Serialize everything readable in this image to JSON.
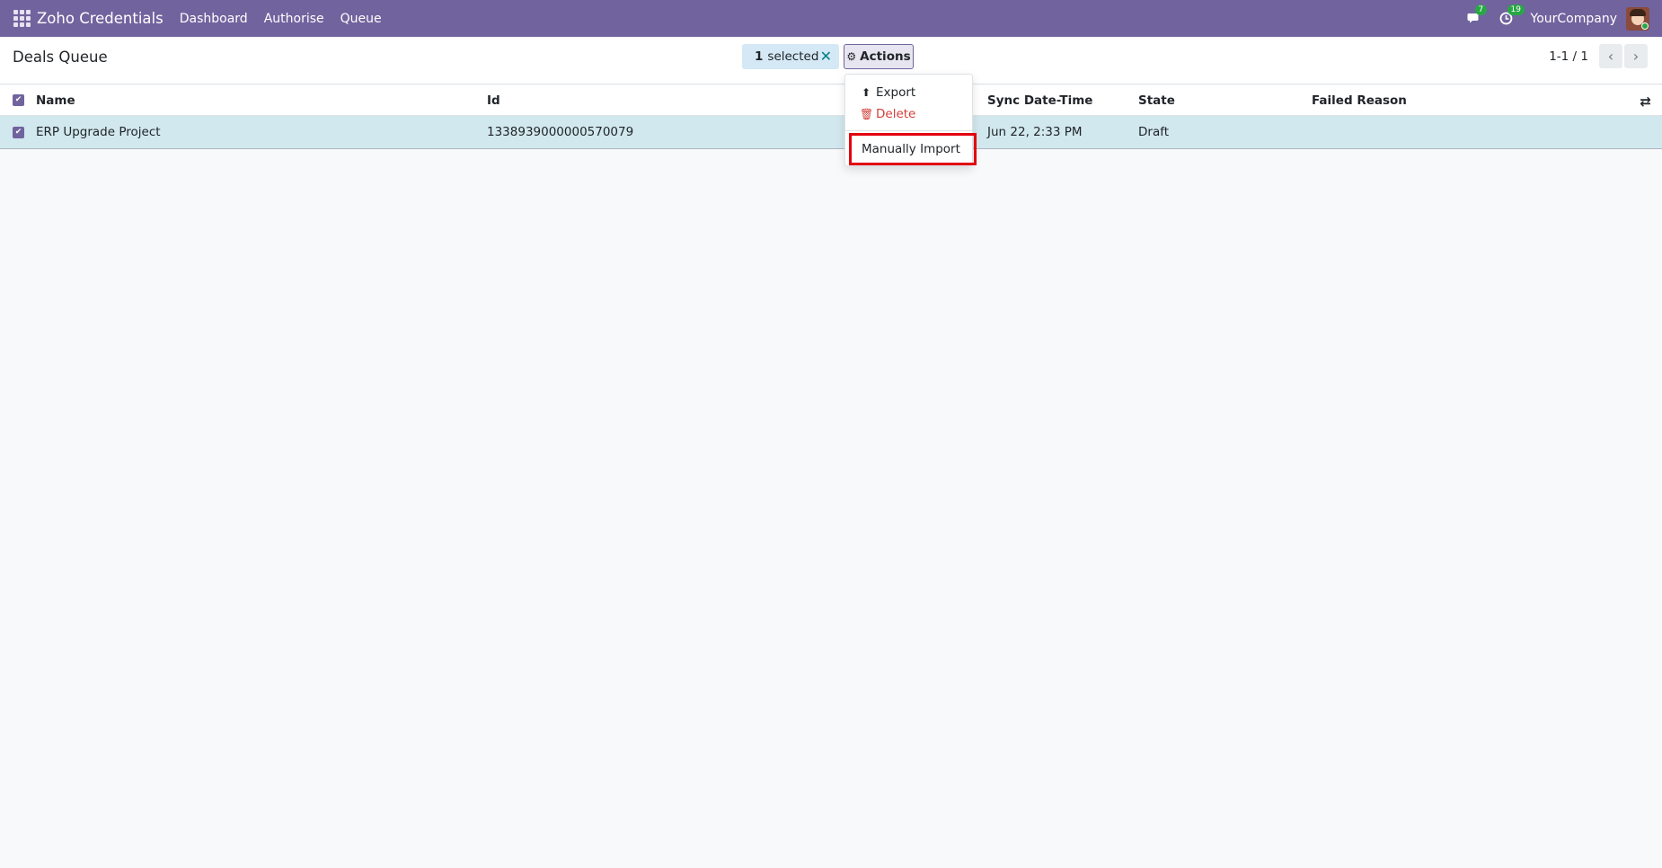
{
  "navbar": {
    "app_title": "Zoho Credentials",
    "menu": [
      "Dashboard",
      "Authorise",
      "Queue"
    ],
    "messages_badge": "7",
    "activities_badge": "19",
    "company": "YourCompany",
    "icons": [
      "apps-grid-icon",
      "chat-icon",
      "clock-icon",
      "avatar"
    ]
  },
  "control_panel": {
    "title": "Deals Queue",
    "selected_count": "1",
    "selected_label": "selected",
    "actions_label": "Actions",
    "pager": "1-1 / 1"
  },
  "table": {
    "columns": [
      "Name",
      "Id",
      "Sync Date-Time",
      "State",
      "Failed Reason"
    ],
    "rows": [
      {
        "selected": true,
        "name": "ERP Upgrade Project",
        "id": "1338939000000570079",
        "sync_datetime": "Jun 22, 2:33 PM",
        "state": "Draft",
        "failed_reason": ""
      }
    ]
  },
  "actions_menu": {
    "items": [
      "Export",
      "Delete",
      "Manually Import"
    ],
    "highlighted": "Manually Import"
  },
  "colors": {
    "navbar": "#71639e",
    "selected_row": "#d1e8ee",
    "delete": "#d23f3a",
    "highlight_box": "#e3000f"
  }
}
